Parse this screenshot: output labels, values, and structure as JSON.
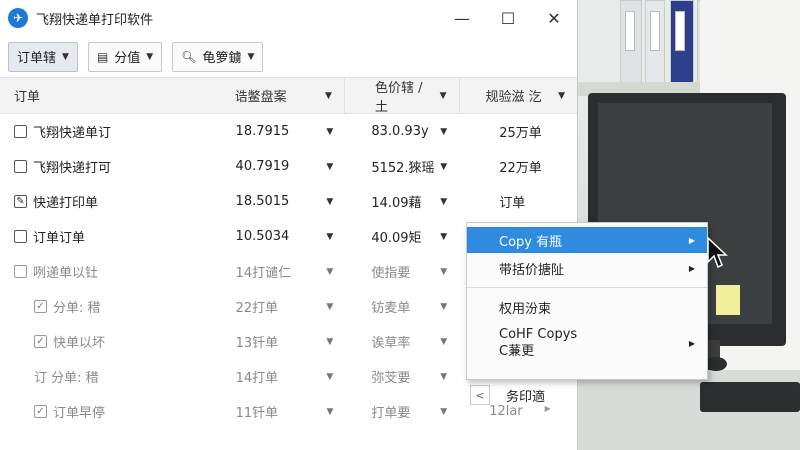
{
  "window": {
    "title": "飞翔快递单打印软件",
    "controls": {
      "minimize": "—",
      "maximize": "☐",
      "close": "✕"
    }
  },
  "toolbar": {
    "btn1_label": "订单辖",
    "btn2_label": "分值",
    "btn3_label": "龟箩鐪"
  },
  "table": {
    "headers": {
      "c1": "订单",
      "c2": "诰鳖盘案",
      "c3": "色价辖 / 土",
      "c4": "规验滋 汔"
    },
    "rows": [
      {
        "name": "飞翔快递单订",
        "v2": "18.7915",
        "v3": "83.0.93y",
        "v4": "25万单"
      },
      {
        "name": "飞翔快递打可",
        "v2": "40.7919",
        "v3": "5152.猍瑶",
        "v4": "22万单"
      },
      {
        "name": "快递打印单",
        "v2": "18.5015",
        "v3": "14.09藉",
        "v4": "订单"
      },
      {
        "name": "订单订单",
        "v2": "10.5034",
        "v3": "40.09矩",
        "v4": ""
      },
      {
        "name": "咧递单以钍",
        "v2": "14打谴仁",
        "v3": "使指要",
        "v4": ""
      },
      {
        "name": "分单: 稓",
        "v2": "22打单",
        "v3": "钫麦单",
        "v4": ""
      },
      {
        "name": "快单以坏",
        "v2": "13钎单",
        "v3": "诶草率",
        "v4": ""
      },
      {
        "name": "订 分单: 稓",
        "v2": "14打单",
        "v3": "弥芠要",
        "v4": "务印適"
      },
      {
        "name": "订单早停",
        "v2": "11钎单",
        "v3": "打单要",
        "v4": "12lar"
      }
    ]
  },
  "context_menu": {
    "items": [
      {
        "label": "Copy 有瓶",
        "submenu": true
      },
      {
        "label": "带括价搪阯",
        "submenu": true
      },
      {
        "label": "权用汾柬",
        "submenu": false
      },
      {
        "label": "CoHF Copys",
        "label2": "C蒹更",
        "submenu": true
      }
    ]
  },
  "colors": {
    "accent": "#2f8be0",
    "app_icon": "#1e78d7"
  }
}
